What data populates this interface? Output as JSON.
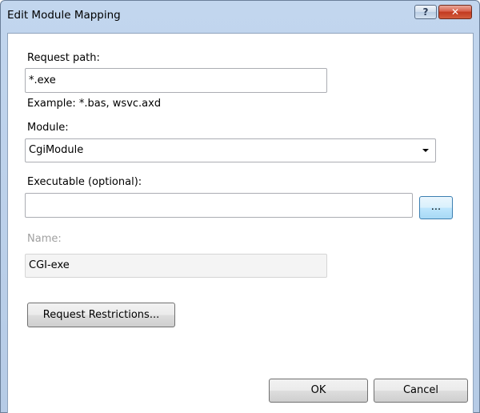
{
  "window": {
    "title": "Edit Module Mapping",
    "help_label": "?",
    "close_label": "✕"
  },
  "form": {
    "request_path": {
      "label": "Request path:",
      "value": "*.exe",
      "example": "Example: *.bas, wsvc.axd"
    },
    "module": {
      "label": "Module:",
      "selected": "CgiModule"
    },
    "executable": {
      "label": "Executable (optional):",
      "value": "",
      "browse_label": "..."
    },
    "name": {
      "label": "Name:",
      "value": "CGI-exe"
    },
    "restrictions_button": "Request Restrictions..."
  },
  "buttons": {
    "ok": "OK",
    "cancel": "Cancel"
  }
}
